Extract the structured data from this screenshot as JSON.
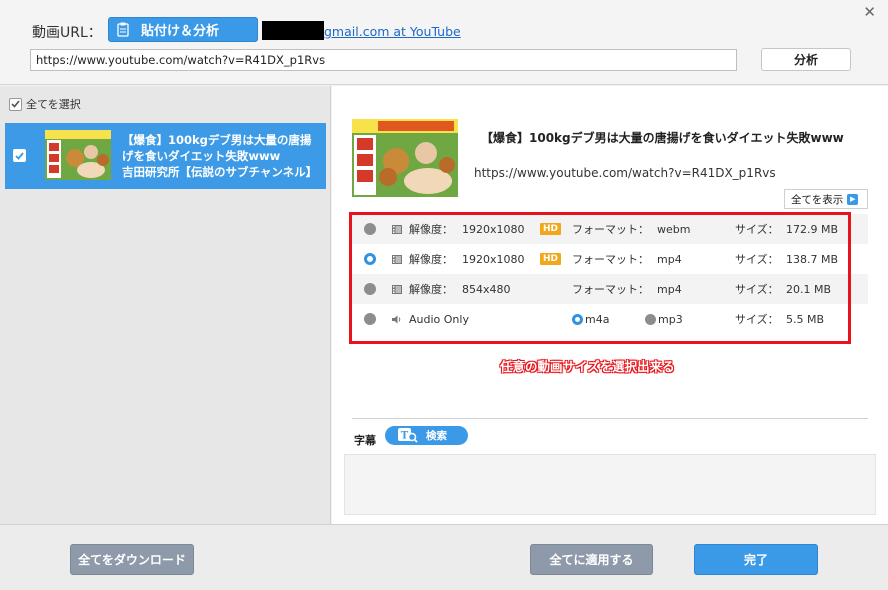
{
  "header": {
    "url_label": "動画URL：",
    "paste_button": "貼付け＆分析",
    "account_link": "gmail.com at YouTube",
    "url_value": "https://www.youtube.com/watch?v=R41DX_p1Rvs",
    "analyze_button": "分析"
  },
  "sidebar": {
    "select_all": "全てを選択",
    "items": [
      {
        "title": "【爆食】100kgデブ男は大量の唐揚げを食いダイエット失敗www",
        "channel": "吉田研究所【伝説のサブチャンネル】"
      }
    ]
  },
  "video": {
    "title": "【爆食】100kgデブ男は大量の唐揚げを食いダイエット失敗www",
    "url": "https://www.youtube.com/watch?v=R41DX_p1Rvs",
    "show_all": "全てを表示"
  },
  "formats": [
    {
      "res_label": "解像度：",
      "resolution": "1920x1080",
      "hd": "HD",
      "fmt_label": "フォーマット：",
      "format": "webm",
      "size_label": "サイズ：",
      "size": "172.9 MB"
    },
    {
      "res_label": "解像度：",
      "resolution": "1920x1080",
      "hd": "HD",
      "fmt_label": "フォーマット：",
      "format": "mp4",
      "size_label": "サイズ：",
      "size": "138.7 MB"
    },
    {
      "res_label": "解像度：",
      "resolution": "854x480",
      "fmt_label": "フォーマット：",
      "format": "mp4",
      "size_label": "サイズ：",
      "size": "20.1 MB"
    },
    {
      "audio_label": "Audio Only",
      "opt1": "m4a",
      "opt2": "mp3",
      "size_label": "サイズ：",
      "size": "5.5 MB"
    }
  ],
  "selected_format_index": 1,
  "annotation": "任意の動画サイズを選択出来る",
  "subtitle": {
    "label": "字幕",
    "search_button": "検索"
  },
  "footer": {
    "download_all": "全てをダウンロード",
    "apply_all": "全てに適用する",
    "done": "完了"
  },
  "colors": {
    "accent": "#3a9ae8",
    "annotation_red": "#e8141b",
    "hd_badge": "#f2a81b"
  }
}
